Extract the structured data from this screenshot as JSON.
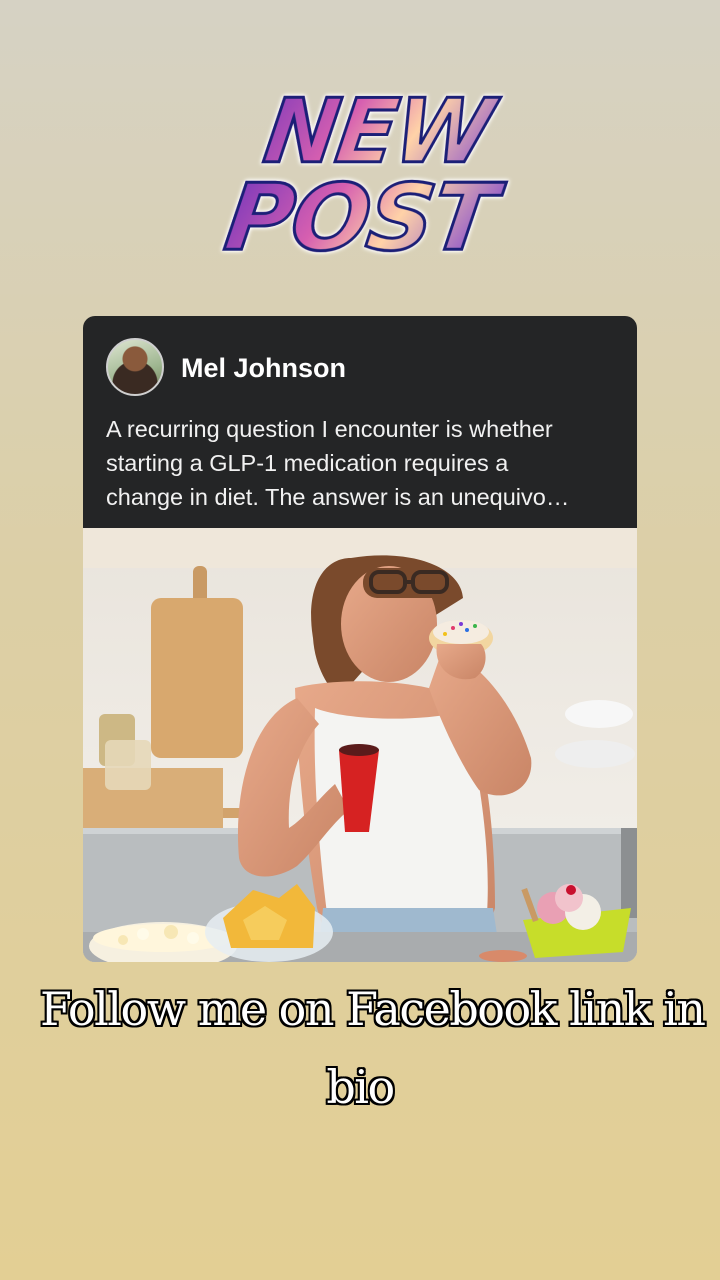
{
  "header": {
    "line1": "NEW",
    "line2": "POST"
  },
  "post": {
    "author": "Mel Johnson",
    "avatar_icon": "profile-photo",
    "text_lines": [
      "A recurring question I encounter is whether",
      "starting a GLP-1 medication requires a",
      "change in diet. The answer is an unequivo…"
    ]
  },
  "caption": {
    "line1": "Follow me on Facebook link in",
    "line2": "bio"
  },
  "colors": {
    "card_background": "#242526",
    "page_top": "#d6d2c4",
    "page_bottom": "#e3cf94"
  }
}
